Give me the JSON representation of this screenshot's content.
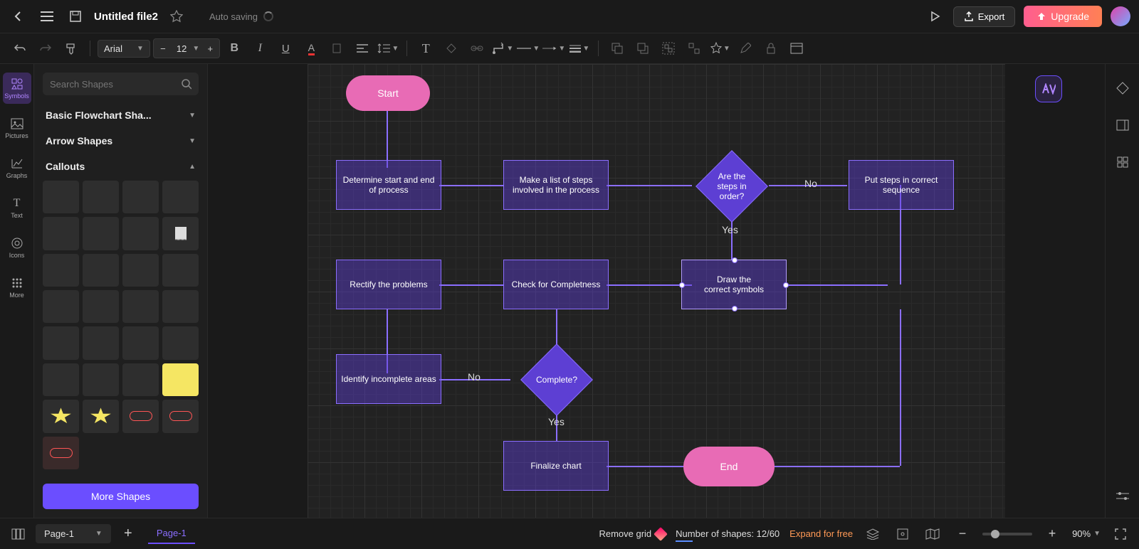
{
  "header": {
    "file_title": "Untitled file2",
    "auto_save": "Auto saving",
    "export": "Export",
    "upgrade": "Upgrade"
  },
  "toolbar": {
    "font_family": "Arial",
    "font_size": "12"
  },
  "left_rail": {
    "items": [
      {
        "label": "Symbols"
      },
      {
        "label": "Pictures"
      },
      {
        "label": "Graphs"
      },
      {
        "label": "Text"
      },
      {
        "label": "Icons"
      },
      {
        "label": "More"
      }
    ]
  },
  "side_panel": {
    "search_placeholder": "Search Shapes",
    "categories": {
      "basic": "Basic Flowchart Sha...",
      "arrow": "Arrow Shapes",
      "callouts": "Callouts"
    },
    "more_shapes": "More Shapes"
  },
  "flow": {
    "start": "Start",
    "end": "End",
    "determine": "Determine start and end of process",
    "makelist": "Make a list of steps involved in the process",
    "inorder": "Are the steps in order?",
    "putsteps": "Put steps in correct sequence",
    "rectify": "Rectify the problems",
    "check": "Check for Completness",
    "draw": "Draw the\ncorrect symbols",
    "identify": "Identify incomplete areas",
    "complete": "Complete?",
    "finalize": "Finalize chart",
    "no": "No",
    "yes": "Yes"
  },
  "footer": {
    "page": "Page-1",
    "page_tab": "Page-1",
    "remove_grid": "Remove grid",
    "shape_count_label": "Number of shapes: ",
    "shape_count": "12/60",
    "expand": "Expand for free",
    "zoom": "90%"
  }
}
